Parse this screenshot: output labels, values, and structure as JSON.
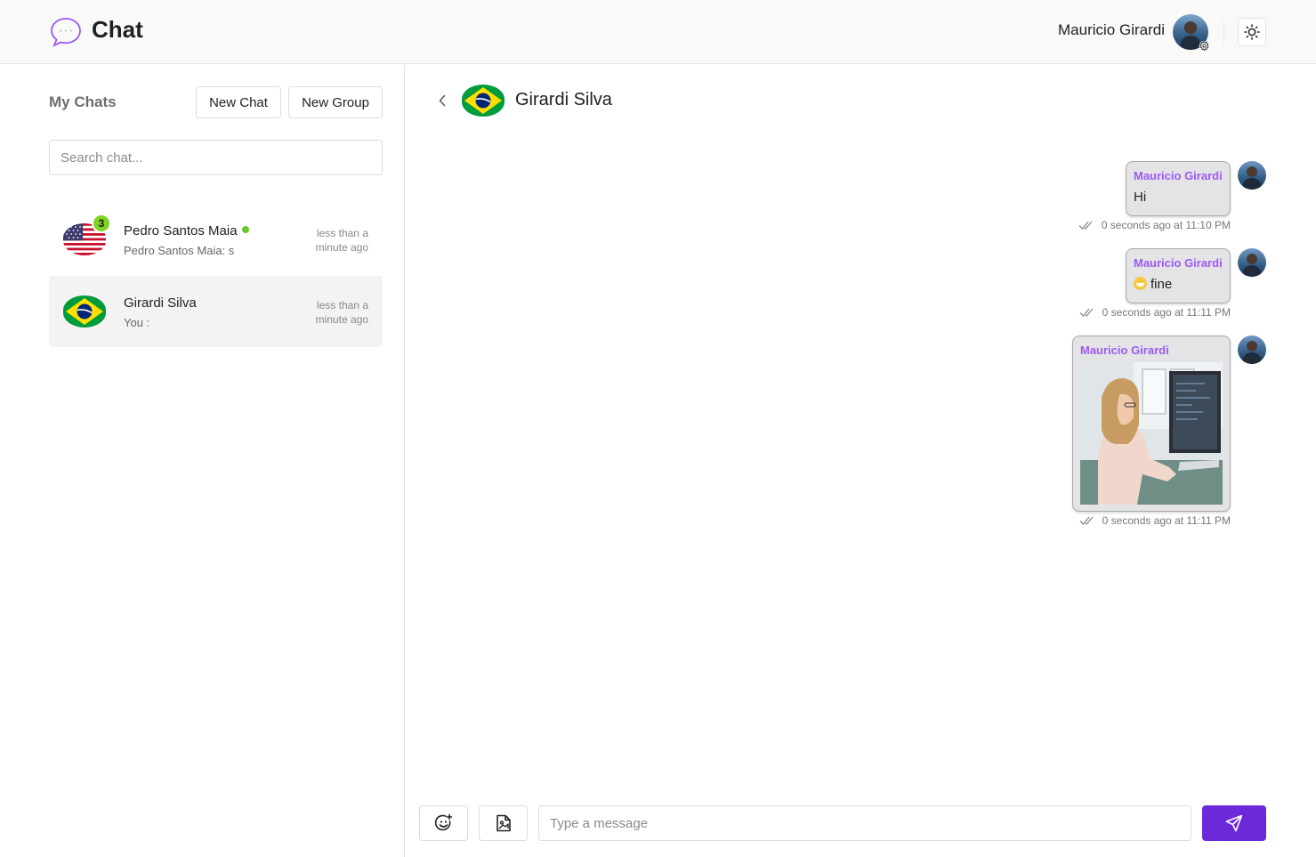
{
  "header": {
    "app_title": "Chat",
    "user_name": "Mauricio Girardi"
  },
  "sidebar": {
    "title": "My Chats",
    "new_chat_label": "New Chat",
    "new_group_label": "New Group",
    "search_placeholder": "Search chat...",
    "chats": [
      {
        "name": "Pedro Santos Maia",
        "preview": "Pedro Santos Maia: s",
        "time": "less than a minute ago",
        "unread": "3",
        "online": true,
        "flag": "usa-flag"
      },
      {
        "name": "Girardi Silva",
        "preview": "You :",
        "time": "less than a minute ago",
        "flag": "brazil-flag",
        "active": true
      }
    ]
  },
  "conversation": {
    "title": "Girardi Silva",
    "messages": [
      {
        "sender": "Mauricio Girardi",
        "text": "Hi",
        "meta": "0 seconds ago at 11:10 PM"
      },
      {
        "sender": "Mauricio Girardi",
        "text": "fine",
        "emoji": "grinning-face",
        "meta": "0 seconds ago at 11:11 PM"
      },
      {
        "sender": "Mauricio Girardi",
        "image": "woman-at-computer-photo",
        "meta": "0 seconds ago at 11:11 PM"
      }
    ]
  },
  "composer": {
    "placeholder": "Type a message"
  },
  "colors": {
    "accent": "#6d28d9",
    "sender_name": "#9b59f5",
    "online": "#6bc72a",
    "badge": "#7ed321"
  }
}
